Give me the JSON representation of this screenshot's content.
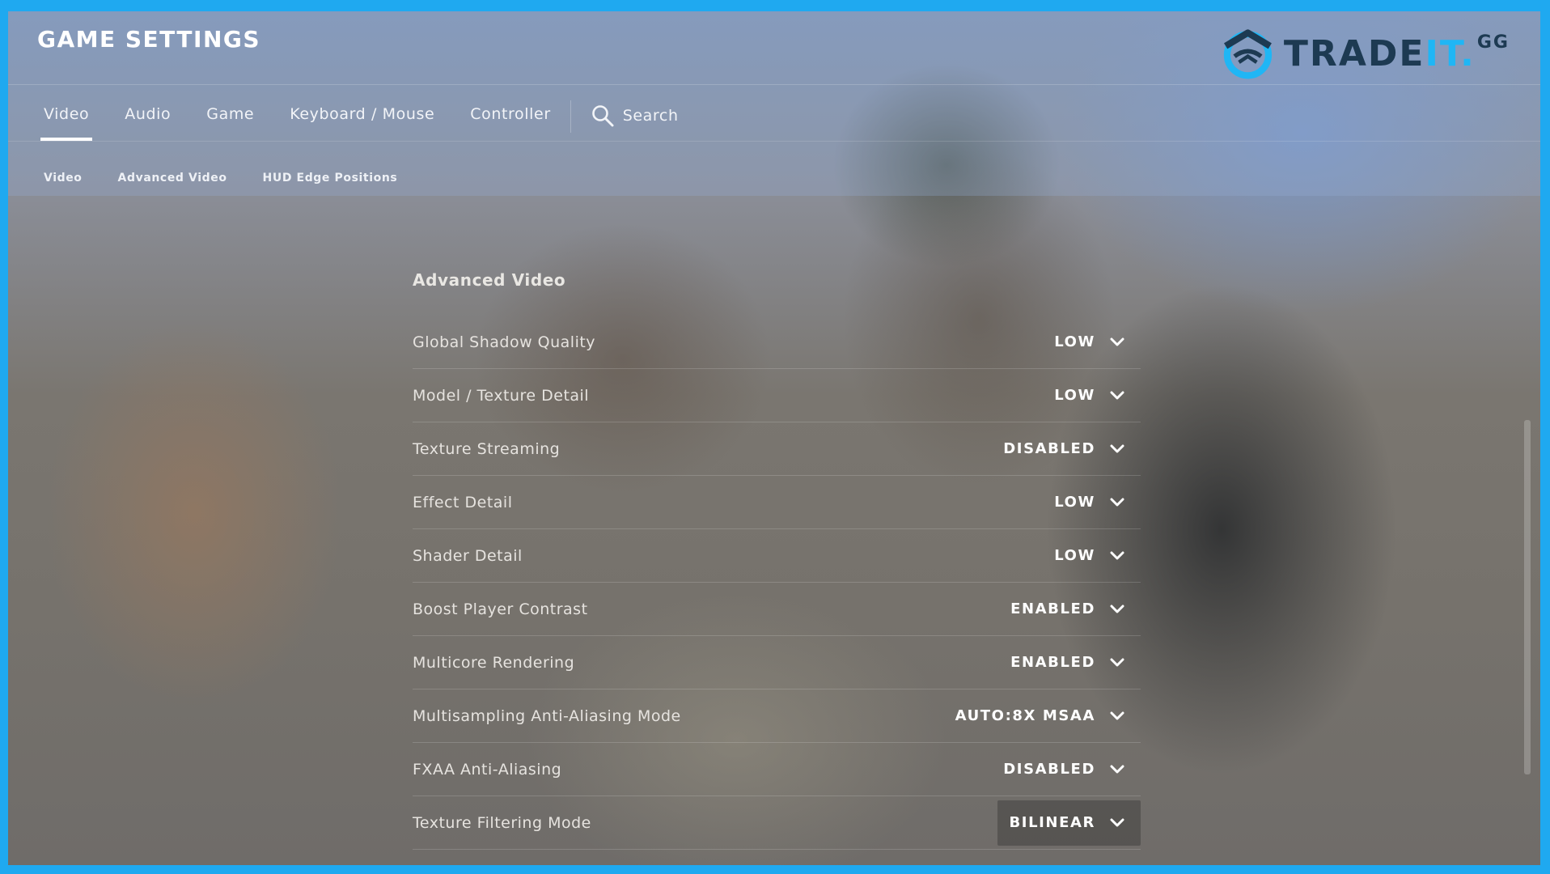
{
  "header": {
    "title": "GAME SETTINGS",
    "logo": {
      "main": "TRADE",
      "accent": "IT",
      "dot": ".",
      "suffix": "GG"
    }
  },
  "tabs": [
    {
      "label": "Video",
      "active": true
    },
    {
      "label": "Audio",
      "active": false
    },
    {
      "label": "Game",
      "active": false
    },
    {
      "label": "Keyboard / Mouse",
      "active": false
    },
    {
      "label": "Controller",
      "active": false
    }
  ],
  "search": {
    "label": "Search",
    "icon": "search-icon"
  },
  "subtabs": [
    {
      "label": "Video"
    },
    {
      "label": "Advanced Video"
    },
    {
      "label": "HUD Edge Positions"
    }
  ],
  "section": {
    "title": "Advanced Video",
    "settings": [
      {
        "label": "Global Shadow Quality",
        "value": "LOW"
      },
      {
        "label": "Model / Texture Detail",
        "value": "LOW"
      },
      {
        "label": "Texture Streaming",
        "value": "DISABLED"
      },
      {
        "label": "Effect Detail",
        "value": "LOW"
      },
      {
        "label": "Shader Detail",
        "value": "LOW"
      },
      {
        "label": "Boost Player Contrast",
        "value": "ENABLED"
      },
      {
        "label": "Multicore Rendering",
        "value": "ENABLED"
      },
      {
        "label": "Multisampling Anti-Aliasing Mode",
        "value": "AUTO:8X MSAA"
      },
      {
        "label": "FXAA Anti-Aliasing",
        "value": "DISABLED"
      },
      {
        "label": "Texture Filtering Mode",
        "value": "BILINEAR"
      }
    ]
  },
  "colors": {
    "frame": "#1fa9f0",
    "logo_dark": "#1d3a52",
    "logo_accent": "#1fb6f5"
  }
}
